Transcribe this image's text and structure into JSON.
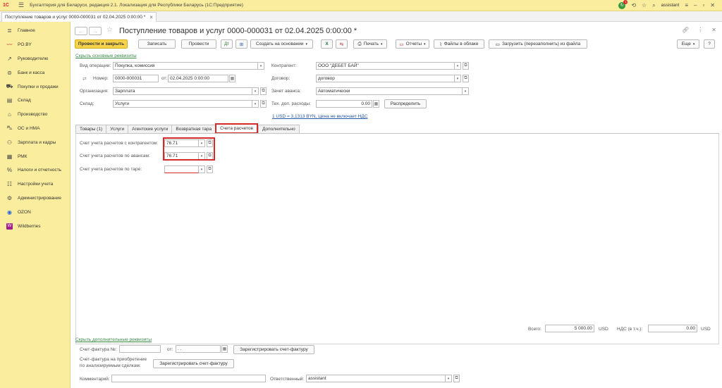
{
  "app": {
    "logo": "1С",
    "title": "Бухгалтерия для Беларуси, редакция 2.1. Локализация для Республики Беларусь   (1С:Предприятие)",
    "notif_count": "1",
    "user": "assistant"
  },
  "doc_tab": {
    "label": "Поступление товаров и услуг 0000-000031 от 02.04.2025 0:00:00 *",
    "close": "×"
  },
  "sidebar": {
    "items": [
      {
        "label": "Главное",
        "icon": "menu-lines-icon"
      },
      {
        "label": "PO.BY",
        "icon": "heartbeat-icon"
      },
      {
        "label": "Руководителю",
        "icon": "chart-line-icon"
      },
      {
        "label": "Банк и касса",
        "icon": "bank-icon"
      },
      {
        "label": "Покупки и продажи",
        "icon": "cart-icon"
      },
      {
        "label": "Склад",
        "icon": "warehouse-icon"
      },
      {
        "label": "Производство",
        "icon": "factory-icon"
      },
      {
        "label": "ОС и НМА",
        "icon": "truck-icon"
      },
      {
        "label": "Зарплата и кадры",
        "icon": "people-icon"
      },
      {
        "label": "РМК",
        "icon": "cash-register-icon"
      },
      {
        "label": "Налоги и отчетность",
        "icon": "percent-icon"
      },
      {
        "label": "Настройки учета",
        "icon": "settings-list-icon"
      },
      {
        "label": "Администрирование",
        "icon": "gear-icon"
      },
      {
        "label": "OZON",
        "icon": "ozon-icon"
      },
      {
        "label": "Wildberries",
        "icon": "wildberries-icon"
      }
    ]
  },
  "form": {
    "title": "Поступление товаров и услуг 0000-000031 от 02.04.2025 0:00:00 *",
    "toolbar": {
      "post_close": "Провести и закрыть",
      "save": "Записать",
      "post": "Провести",
      "create_based": "Создать на основании",
      "print": "Печать",
      "reports": "Отчеты",
      "cloud_files": "Файлы в облаке",
      "load_file": "Загрузить (перезаполнить) из файла",
      "more": "Еще",
      "help": "?"
    },
    "hide_main_link": "Скрыть основные реквизиты",
    "op_type": {
      "label": "Вид операции:",
      "value": "Покупка, комиссия"
    },
    "number": {
      "label": "Номер:",
      "value": "0000-000031",
      "date_label": "от:",
      "date": "02.04.2025  0:00:00"
    },
    "organization": {
      "label": "Организация:",
      "value": "Зарплата"
    },
    "warehouse": {
      "label": "Склад:",
      "value": "Услуги"
    },
    "counterparty": {
      "label": "Контрагент:",
      "value": "ООО \"ДЕБЕТ БАЙ\""
    },
    "contract": {
      "label": "Договор:",
      "value": "договор"
    },
    "advance": {
      "label": "Зачет аванса:",
      "value": "Автоматически"
    },
    "extra_costs": {
      "label": "Тех. доп. расходы:",
      "value": "0.00",
      "button": "Распределить"
    },
    "currency_link": "1 USD = 3,1313 BYN, Цена не включает НДС",
    "tabs": [
      "Товары (1)",
      "Услуги",
      "Агентские услуги",
      "Возвратная тара",
      "Счета расчетов",
      "Дополнительно"
    ],
    "accounts": {
      "contractor": {
        "label": "Счет учета расчетов с контрагентом:",
        "value": "76.71"
      },
      "advances": {
        "label": "Счет учета расчетов по авансам:",
        "value": "76.71"
      },
      "tare": {
        "label": "Счет учета расчетов по таре:",
        "value": ""
      }
    },
    "totals": {
      "total_label": "Всего:",
      "total": "5 000.00",
      "currency": "USD",
      "vat_label": "НДС (в т.ч.):",
      "vat": "0.00",
      "vat_currency": "USD"
    },
    "hide_extra_link": "Скрыть дополнительные реквизиты",
    "invoice": {
      "label": "Счет-фактура №:",
      "value": "",
      "date_label": "от:",
      "date": " .  .    ",
      "button": "Зарегистрировать счет-фактуру"
    },
    "invoice2": {
      "label1": "Счет-фактура на приобретение",
      "label2": "по анализируемым сделкам:",
      "button": "Зарегистрировать счет-фактуру"
    },
    "comment": {
      "label": "Комментарий:",
      "value": ""
    },
    "responsible": {
      "label": "Ответственный:",
      "value": "assistant"
    }
  }
}
